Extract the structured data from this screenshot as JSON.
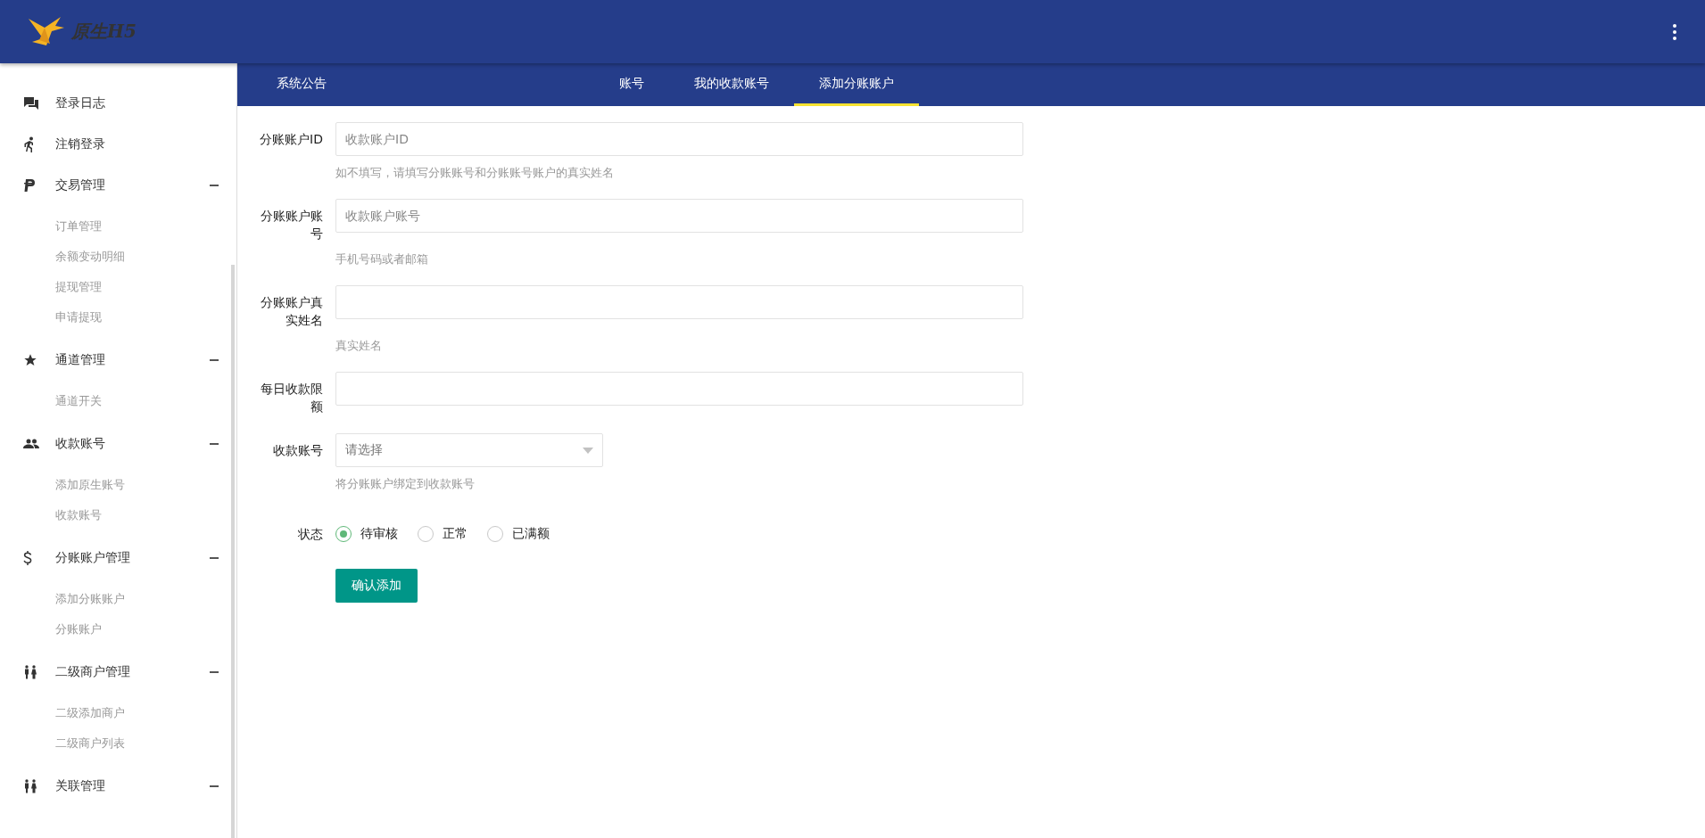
{
  "header": {
    "logo_text": "原生H5"
  },
  "sidebar": {
    "links": [
      {
        "label": "登录日志"
      },
      {
        "label": "注销登录"
      }
    ],
    "groups": [
      {
        "label": "交易管理",
        "expanded": true,
        "children": [
          {
            "label": "订单管理"
          },
          {
            "label": "余额变动明细"
          },
          {
            "label": "提现管理"
          },
          {
            "label": "申请提现"
          }
        ]
      },
      {
        "label": "通道管理",
        "expanded": true,
        "children": [
          {
            "label": "通道开关"
          }
        ]
      },
      {
        "label": "收款账号",
        "expanded": true,
        "children": [
          {
            "label": "添加原生账号"
          },
          {
            "label": "收款账号"
          }
        ]
      },
      {
        "label": "分账账户管理",
        "expanded": true,
        "children": [
          {
            "label": "添加分账账户"
          },
          {
            "label": "分账账户"
          }
        ]
      },
      {
        "label": "二级商户管理",
        "expanded": true,
        "children": [
          {
            "label": "二级添加商户"
          },
          {
            "label": "二级商户列表"
          }
        ]
      },
      {
        "label": "关联管理",
        "expanded": true
      }
    ]
  },
  "tabs": [
    {
      "label": "系统公告",
      "selected": false
    },
    {
      "label": "账号",
      "selected": false
    },
    {
      "label": "我的收款账号",
      "selected": false
    },
    {
      "label": "添加分账账户",
      "selected": true
    }
  ],
  "form": {
    "fields": [
      {
        "kind": "text",
        "label": "分账账户ID",
        "placeholder": "收款账户ID",
        "hint": "如不填写，请填写分账账号和分账账号账户的真实姓名"
      },
      {
        "kind": "text",
        "label": "分账账户账号",
        "placeholder": "收款账户账号",
        "hint": "手机号码或者邮箱"
      },
      {
        "kind": "text",
        "label": "分账账户真实姓名",
        "hint": "真实姓名"
      },
      {
        "kind": "text",
        "label": "每日收款限额"
      },
      {
        "kind": "select",
        "label": "收款账号",
        "placeholder": "请选择",
        "hint": "将分账账户绑定到收款账号"
      },
      {
        "kind": "radio",
        "label": "状态",
        "options": [
          {
            "label": "待审核",
            "selected": true
          },
          {
            "label": "正常",
            "selected": false
          },
          {
            "label": "已满额",
            "selected": false
          }
        ]
      }
    ],
    "submit": "确认添加"
  }
}
